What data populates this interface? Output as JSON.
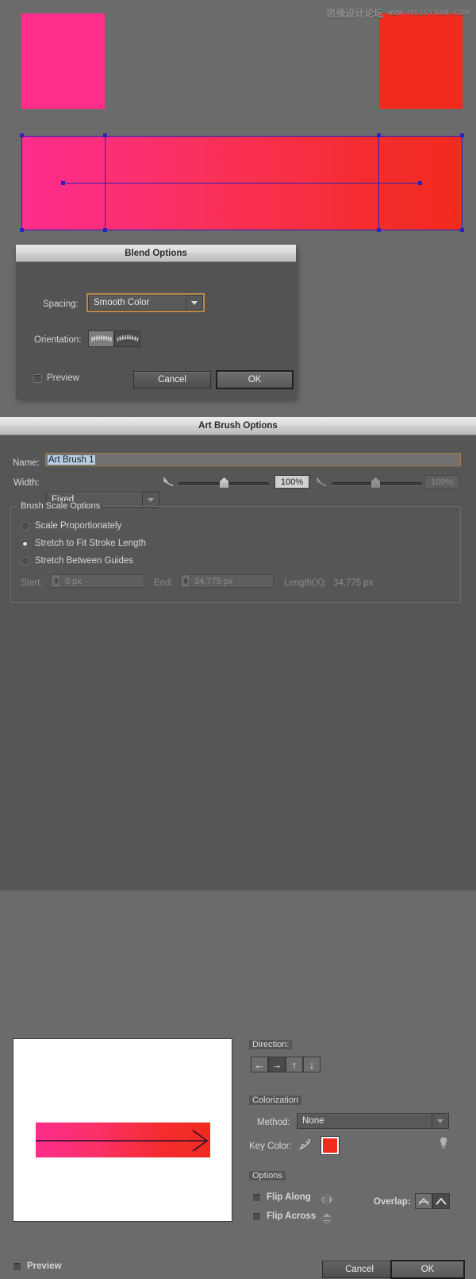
{
  "watermark": {
    "cn_text": "思缘设计论坛",
    "url_text": "WWW.MISSYUAN.COM"
  },
  "canvas": {
    "pink_color": "#ff2d8c",
    "red_color": "#f02b1d",
    "selection_color": "#2a24b8"
  },
  "blend_dialog": {
    "title": "Blend Options",
    "spacing_label": "Spacing:",
    "spacing_value": "Smooth Color",
    "orientation_label": "Orientation:",
    "orientation_align_page": "align-to-page",
    "orientation_align_path": "align-to-path",
    "preview_label": "Preview",
    "preview_checked": false,
    "cancel_label": "Cancel",
    "ok_label": "OK"
  },
  "art_dialog": {
    "title": "Art Brush Options",
    "name_label": "Name:",
    "name_value": "Art Brush 1",
    "width_label": "Width:",
    "width_value": "Fixed",
    "slider1_value": "100%",
    "slider2_value": "100%",
    "scale_group": {
      "legend": "Brush Scale Options",
      "options": [
        {
          "label": "Scale Proportionately",
          "selected": false
        },
        {
          "label": "Stretch to Fit Stroke Length",
          "selected": true
        },
        {
          "label": "Stretch Between Guides",
          "selected": false
        }
      ],
      "start_label": "Start:",
      "start_value": "0 px",
      "end_label": "End:",
      "end_value": "34,775 px",
      "length_label": "Length(X):",
      "length_value": "34,775 px"
    },
    "direction": {
      "legend": "Direction:",
      "buttons": [
        {
          "name": "direction-left",
          "glyph": "←",
          "selected": false
        },
        {
          "name": "direction-right",
          "glyph": "→",
          "selected": true
        },
        {
          "name": "direction-up",
          "glyph": "↑",
          "selected": false
        },
        {
          "name": "direction-down",
          "glyph": "↓",
          "selected": false
        }
      ]
    },
    "colorization": {
      "legend": "Colorization",
      "method_label": "Method:",
      "method_value": "None",
      "key_color_label": "Key Color:",
      "key_color_value": "#f02b1d",
      "eyedropper_icon": "eyedropper-icon",
      "tip_icon": "lightbulb-icon"
    },
    "options": {
      "legend": "Options",
      "flip_along_label": "Flip Along",
      "flip_along_checked": false,
      "flip_across_label": "Flip Across",
      "flip_across_checked": false,
      "overlap_label": "Overlap:",
      "overlap_selected_index": 1
    },
    "preview_label": "Preview",
    "preview_checked": false,
    "cancel_label": "Cancel",
    "ok_label": "OK"
  }
}
